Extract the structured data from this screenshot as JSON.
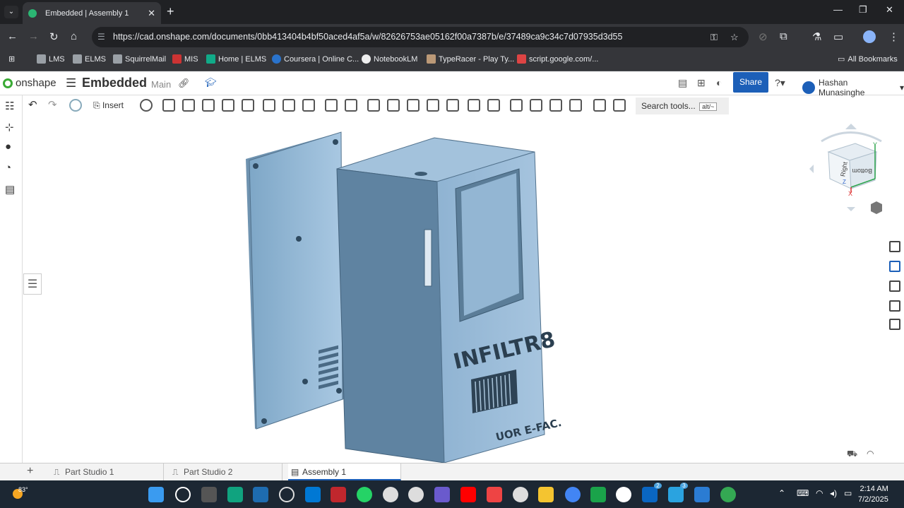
{
  "browser": {
    "tab_title": "Embedded | Assembly 1",
    "url": "https://cad.onshape.com/documents/0bb413404b4bf50aced4af5a/w/82626753ae05162f00a7387b/e/37489ca9c34c7d07935d3d55"
  },
  "bookmarks": [
    "LMS",
    "ELMS",
    "SquirrelMail",
    "MIS",
    "Home | ELMS",
    "Coursera | Online C...",
    "NotebookLM",
    "TypeRacer - Play Ty...",
    "script.google.com/...",
    "All Bookmarks"
  ],
  "app": {
    "logo": "onshape",
    "doc_name": "Embedded",
    "branch": "Main",
    "share_label": "Share",
    "user": "Hashan Munasinghe"
  },
  "toolbar": {
    "insert_label": "Insert",
    "search_label": "Search tools...",
    "search_shortcut": "alt/~",
    "search_key": "c"
  },
  "model": {
    "brand_text": "INFILTR8",
    "footer_text": "UOR E-FAC."
  },
  "viewcube": {
    "right": "Right",
    "bottom": "Bottom",
    "x": "X",
    "y": "Y",
    "z": "Z"
  },
  "bottom_tabs": [
    "Part Studio 1",
    "Part Studio 2",
    "Assembly 1"
  ],
  "taskbar": {
    "time": "2:14 AM",
    "date": "7/2/2025",
    "weather": "83°",
    "badge1": "2",
    "badge2": "3"
  }
}
